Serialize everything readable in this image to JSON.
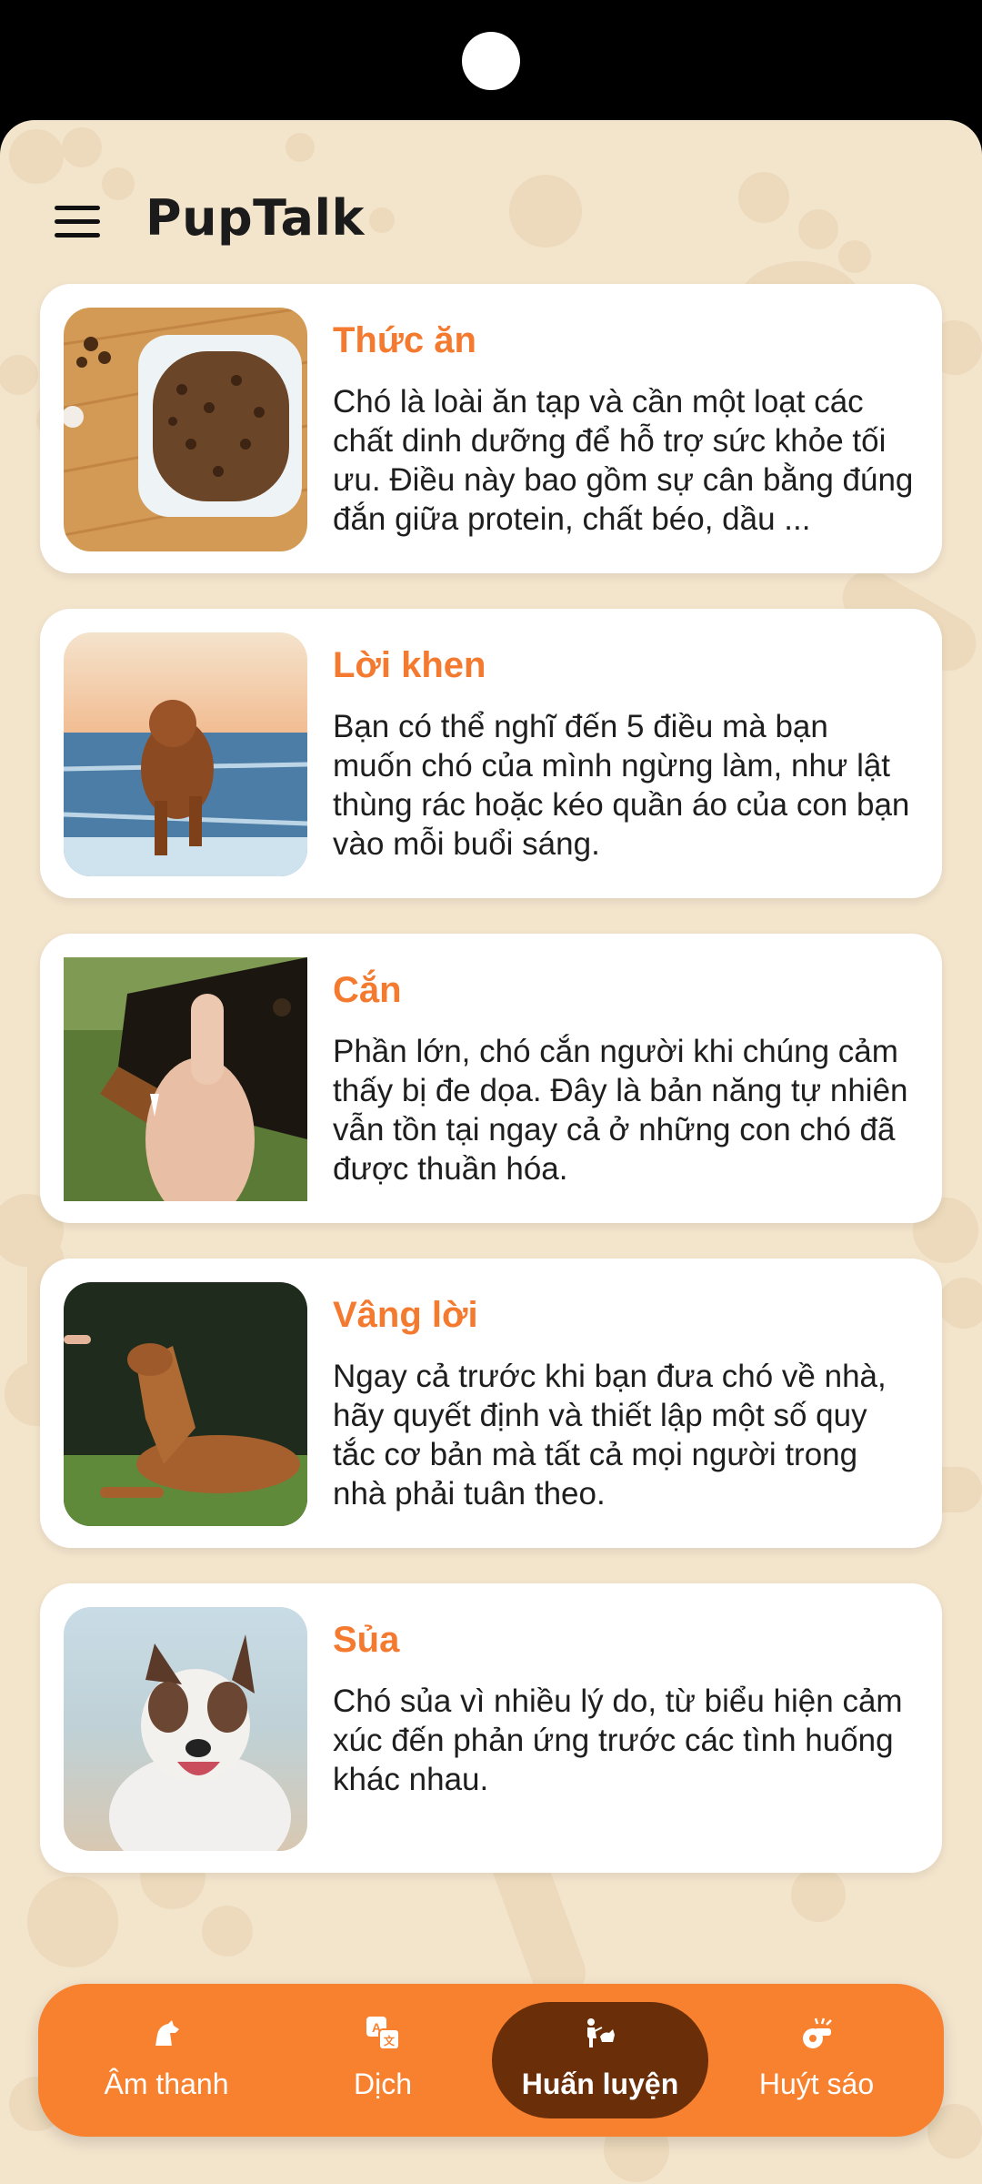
{
  "app": {
    "title": "PupTalk"
  },
  "cards": [
    {
      "title": "Thức ăn",
      "text": "Chó là loài ăn tạp và cần một loạt các chất dinh dưỡng để hỗ trợ sức khỏe tối ưu. Điều này bao gồm sự cân bằng đúng đắn giữa protein, chất béo, dầu ..."
    },
    {
      "title": "Lời khen",
      "text": "Bạn có thể nghĩ đến 5 điều mà bạn muốn chó của mình ngừng làm, như lật thùng rác hoặc kéo quần áo của con bạn vào mỗi buổi sáng."
    },
    {
      "title": "Cắn",
      "text": "Phần lớn, chó cắn người khi chúng cảm thấy bị đe dọa. Đây là bản năng tự nhiên vẫn tồn tại ngay cả ở những con chó đã được thuần hóa."
    },
    {
      "title": "Vâng lời",
      "text": "Ngay cả trước khi bạn đưa chó về nhà, hãy quyết định và thiết lập một số quy tắc cơ bản mà tất cả mọi người trong nhà phải tuân theo."
    },
    {
      "title": "Sủa",
      "text": "Chó sủa vì nhiều lý do, từ biểu hiện cảm xúc đến phản ứng trước các tình huống khác nhau."
    }
  ],
  "nav": [
    {
      "label": "Âm thanh",
      "icon": "dog-sound-icon",
      "active": false
    },
    {
      "label": "Dịch",
      "icon": "translate-icon",
      "active": false
    },
    {
      "label": "Huấn luyện",
      "icon": "training-icon",
      "active": true
    },
    {
      "label": "Huýt sáo",
      "icon": "whistle-icon",
      "active": false
    }
  ],
  "colors": {
    "background": "#f3e4cc",
    "accent": "#f8812f",
    "active_tab": "#6a2e08",
    "title": "#f47a30"
  }
}
